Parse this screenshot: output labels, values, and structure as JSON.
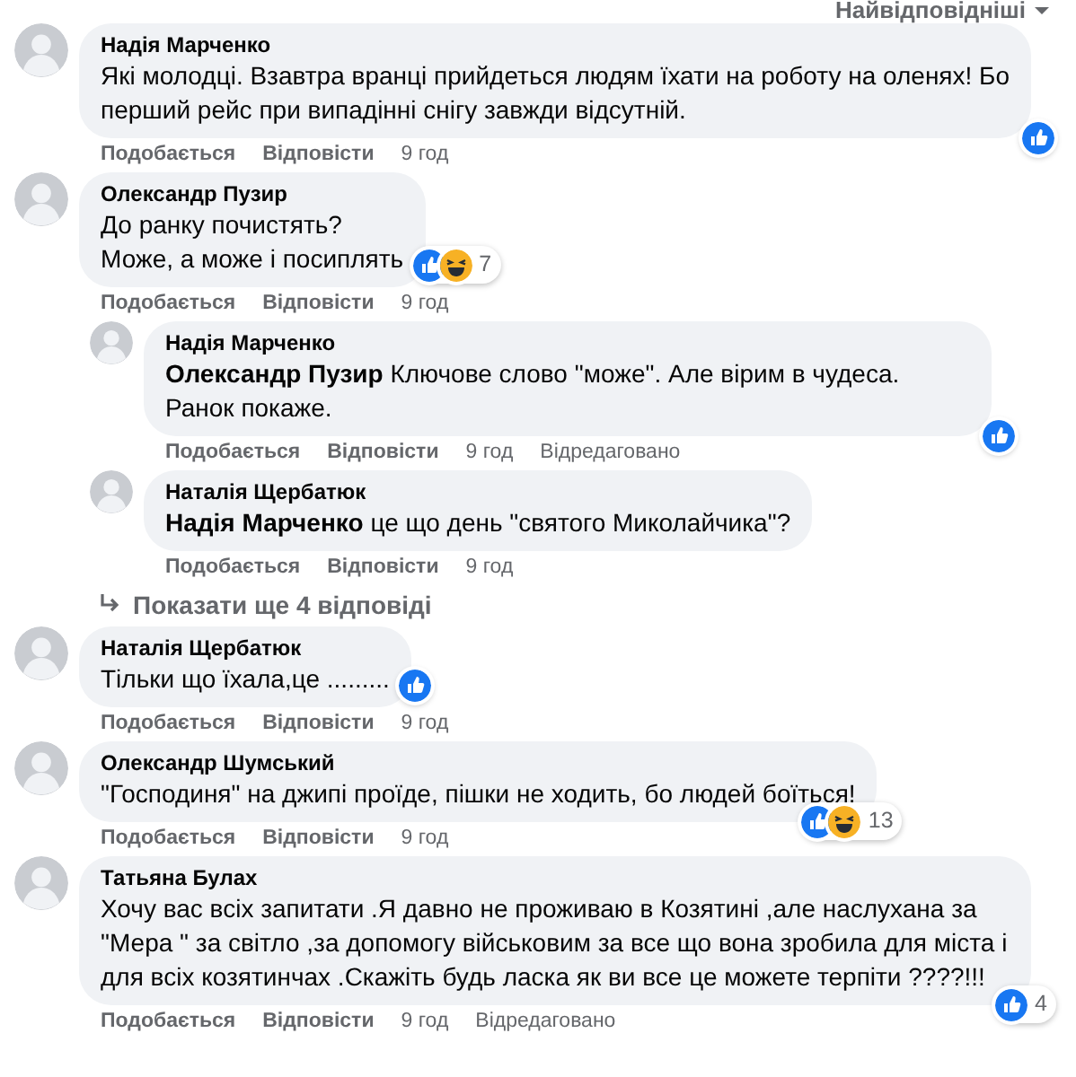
{
  "sort_label": "Найвідповідніші",
  "comments": [
    {
      "author": "Надія Марченко",
      "text": "Які молодці. Взавтра вранці прийдеться людям їхати на роботу на оленях! Бо перший рейс при випадінні снігу завжди відсутній.",
      "like_label": "Подобається",
      "reply_label": "Відповісти",
      "time": "9 год",
      "like": true
    },
    {
      "author": "Олександр Пузир",
      "text": "До ранку почистять?\nМоже, а може і посиплять",
      "like_label": "Подобається",
      "reply_label": "Відповісти",
      "time": "9 год",
      "like": true,
      "haha": true,
      "reaction_count": "7",
      "replies": [
        {
          "author": "Надія Марченко",
          "text": "**Олександр Пузир** Ключове слово \"може\". Але вірим в чудеса. Ранок покаже.",
          "like_label": "Подобається",
          "reply_label": "Відповісти",
          "time": "9 год",
          "edited_label": "Відредаговано",
          "like": true
        },
        {
          "author": "Наталія Щербатюк",
          "text": "**Надія Марченко** це що день \"святого Миколайчика\"?",
          "like_label": "Подобається",
          "reply_label": "Відповісти",
          "time": "9 год"
        }
      ],
      "more_replies": "Показати ще 4 відповіді"
    },
    {
      "author": "Наталія Щербатюк",
      "text": "Тільки що їхала,це .........",
      "like_label": "Подобається",
      "reply_label": "Відповісти",
      "time": "9 год",
      "like": true
    },
    {
      "author": "Олександр Шумський",
      "text": "\"Господиня\" на джипі проїде, пішки не ходить, бо людей боїться!",
      "like_label": "Подобається",
      "reply_label": "Відповісти",
      "time": "9 год",
      "like": true,
      "haha": true,
      "reaction_count": "13"
    },
    {
      "author": "Татьяна Булах",
      "text": "Хочу вас всіх запитати .Я давно не проживаю в Козятині ,але наслухана за \"Мера \" за світло ,за допомогу військовим за все що вона зробила для міста і для всіх козятинчах .Скажіть будь ласка як ви все це можете терпіти ????!!!",
      "like_label": "Подобається",
      "reply_label": "Відповісти",
      "time": "9 год",
      "edited_label": "Відредаговано",
      "like": true,
      "reaction_count": "4"
    }
  ]
}
